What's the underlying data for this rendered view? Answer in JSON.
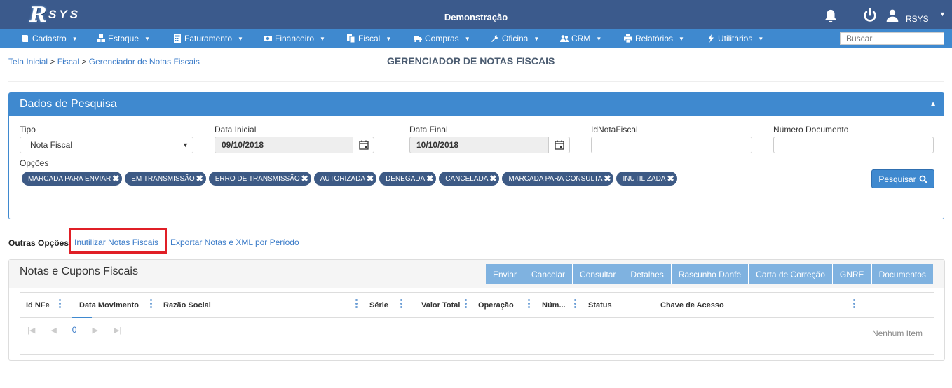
{
  "header": {
    "logo_r": "R",
    "logo_sys": "SYS",
    "title": "Demonstração",
    "user": "RSYS"
  },
  "menu": [
    {
      "label": "Cadastro",
      "icon": "book-icon"
    },
    {
      "label": "Estoque",
      "icon": "cubes-icon"
    },
    {
      "label": "Faturamento",
      "icon": "calculator-icon"
    },
    {
      "label": "Financeiro",
      "icon": "money-icon"
    },
    {
      "label": "Fiscal",
      "icon": "copy-icon"
    },
    {
      "label": "Compras",
      "icon": "truck-icon"
    },
    {
      "label": "Oficina",
      "icon": "wrench-icon"
    },
    {
      "label": "CRM",
      "icon": "users-icon"
    },
    {
      "label": "Relatórios",
      "icon": "print-icon"
    },
    {
      "label": "Utilitários",
      "icon": "bolt-icon"
    }
  ],
  "search": {
    "placeholder": "Buscar"
  },
  "breadcrumb": {
    "home": "Tela Inicial",
    "fiscal": "Fiscal",
    "current": "Gerenciador de Notas Fiscais",
    "sep": ">"
  },
  "page_title": "GERENCIADOR DE NOTAS FISCAIS",
  "search_panel": {
    "title": "Dados de Pesquisa",
    "tipo_label": "Tipo",
    "tipo_value": "Nota Fiscal",
    "data_inicial_label": "Data Inicial",
    "data_inicial_value": "09/10/2018",
    "data_final_label": "Data Final",
    "data_final_value": "10/10/2018",
    "id_label": "IdNotaFiscal",
    "numero_label": "Número Documento",
    "opcoes_label": "Opções",
    "chips": [
      "MARCADA PARA ENVIAR",
      "EM TRANSMISSÃO",
      "ERRO DE TRANSMISSÃO",
      "AUTORIZADA",
      "DENEGADA",
      "CANCELADA",
      "MARCADA PARA CONSULTA",
      "INUTILIZADA"
    ],
    "search_button": "Pesquisar"
  },
  "outras": {
    "label": "Outras Opções",
    "link1": "Inutilizar Notas Fiscais",
    "link2": "Exportar Notas e XML por Período"
  },
  "grid_panel": {
    "title": "Notas e Cupons Fiscais",
    "buttons": [
      "Enviar",
      "Cancelar",
      "Consultar",
      "Detalhes",
      "Rascunho Danfe",
      "Carta de Correção",
      "GNRE",
      "Documentos"
    ],
    "columns": [
      "Id NFe",
      "Data Movimento",
      "Razão Social",
      "Série",
      "Valor Total",
      "Operação",
      "Núm...",
      "Status",
      "Chave de Acesso"
    ],
    "page": "0",
    "empty": "Nenhum Item"
  }
}
